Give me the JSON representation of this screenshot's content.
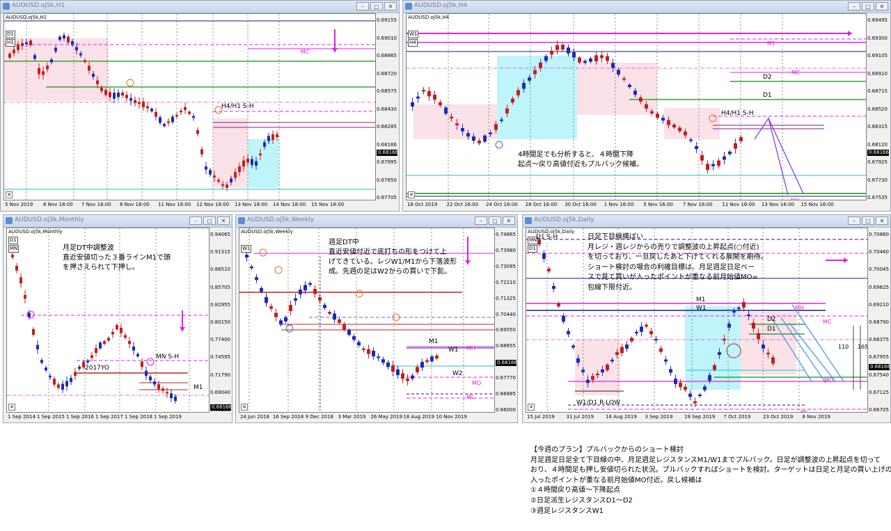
{
  "windows": [
    {
      "id": "h1",
      "title": "AUDUSD.oj5k,H1",
      "symbol": "AUDUSD.oj5k,H1",
      "tf": [
        "D1",
        "H1"
      ],
      "prices": [
        "0.69155",
        "0.69010",
        "0.68865",
        "0.68720",
        "0.68575",
        "0.68430",
        "0.68285",
        "0.68166",
        "0.67995",
        "0.67850",
        "0.67705"
      ],
      "current": "0.68166",
      "times": [
        "5 Nov 2019",
        "6 Nov 18:00",
        "7 Nov 18:00",
        "8 Nov 18:00",
        "11 Nov 18:00",
        "12 Nov 18:00",
        "13 Nov 18:00",
        "14 Nov 18:00",
        "15 Nov 18:00"
      ],
      "labels": [
        "MC",
        "H4/H1 S-H"
      ]
    },
    {
      "id": "h4",
      "title": "AUDUSD.oj5k,H4",
      "symbol": "AUDUSD.oj5k,H4",
      "tf": [
        "W1",
        "H4"
      ],
      "prices": [
        "0.69495",
        "0.69300",
        "0.69105",
        "0.68910",
        "0.68715",
        "0.68520",
        "0.68315",
        "0.68120",
        "0.67925",
        "0.67730",
        "0.67535"
      ],
      "current": "0.68166",
      "times": [
        "18 Oct 2019",
        "22 Oct 16:00",
        "24 Oct 16:00",
        "28 Oct 16:00",
        "30 Oct 16:00",
        "1 Nov 16:00",
        "5 Nov 16:00",
        "7 Nov 16:00",
        "11 Nov 16:00",
        "13 Nov 16:00",
        "15 Nov 16:00"
      ],
      "labels": [
        "M1",
        "MC",
        "D2",
        "D1",
        "H4/H1 S-H",
        "MO"
      ],
      "note": [
        "4時間足でも分析すると、４時間下降",
        "起点～戻り高値付近もプルバック候補。"
      ]
    },
    {
      "id": "mn",
      "title": "AUDUSD.oj5k,Monthly",
      "symbol": "AUDUSD.oj5k,Monthly",
      "tf": [
        "D1",
        "MN"
      ],
      "prices": [
        "0.94065",
        "0.91315",
        "0.88510",
        "0.85705",
        "0.82955",
        "0.80150",
        "0.77400",
        "0.74595",
        "0.71790",
        "0.69040",
        "0.66235"
      ],
      "current": "0.68166",
      "times": [
        "1 Sep 2014",
        "1 Sep 2015",
        "1 Sep 2016",
        "1 Sep 2017",
        "1 Sep 2018",
        "1 Sep 2019"
      ],
      "labels": [
        "MN S-H",
        "2017YO",
        "M1"
      ],
      "note": [
        "月足DT中調整波",
        "直近安値切った３番ラインM1で頭",
        "を押さえられて下押し。"
      ]
    },
    {
      "id": "w1",
      "title": "AUDUSD.oj5k,Weekly",
      "symbol": "AUDUSD.oj5k,Weekly",
      "tf": [
        "W1"
      ],
      "prices": [
        "0.74865",
        "0.73980",
        "0.73095",
        "0.72210",
        "0.71325",
        "0.70440",
        "0.69550",
        "0.68655",
        "0.68166",
        "0.67770",
        "0.66885",
        "0.66000"
      ],
      "current": "0.68166",
      "times": [
        "24 Jun 2018",
        "16 Sep 2018",
        "9 Dec 2018",
        "3 Mar 2019",
        "26 May 2019",
        "18 Aug 2019",
        "10 Nov 2019"
      ],
      "labels": [
        "M1",
        "W1",
        "MH",
        "W2",
        "MO",
        "ML"
      ],
      "note": [
        "週足DT中",
        "直近安値付近で底打ちの形をつけて上",
        "げてきている。レジW1/M1から下落波形",
        "成。先週の足はW2からの買いで下髭。"
      ]
    },
    {
      "id": "d1",
      "title": "AUDUSD.oj5k,Daily",
      "symbol": "AUDUSD.oj5k,Daily",
      "tf": [
        "MN",
        "D1"
      ],
      "prices": [
        "0.70880",
        "0.70460",
        "0.70045",
        "0.69625",
        "0.69210",
        "0.68790",
        "0.68375",
        "0.67955",
        "0.67540",
        "0.67125",
        "0.66705"
      ],
      "current": "0.68166",
      "times": [
        "15 Jul 2019",
        "31 Jul 2019",
        "16 Aug 2019",
        "3 Sep 2019",
        "19 Sep 2019",
        "7 Oct 2019",
        "23 Oct 2019",
        "8 Nov 2019"
      ],
      "labels": [
        "D1 S-H",
        "M1",
        "W1",
        "MH",
        "D2",
        "MC",
        "D1",
        "110",
        "165",
        "MO",
        "W1/D1 R-LOW",
        "ML"
      ],
      "note": [
        "日足下目線横ばい",
        "月レジ・週レジからの売りで調整波の上昇起点(○付近)",
        "を切っており、一旦戻したあと下げてくれる展開を期待。",
        "ショート検討の場合の利確目標は、月足週足日足ベー",
        "スで見て買いが入ったポイントが重なる前月始値MO=",
        "包線下限付近。"
      ]
    }
  ],
  "plan": [
    "【今週のプラン】プルバックからのショート検討",
    "月足週足日足全て下目線の中、月足週足レジスタンスM1/W1までプルバック。日足が調整波の上昇起点を切って",
    "おり、４時間足も押し安値切られた状況。プルバックすればショートを検討。ターゲットは日足と月足の買い上げの",
    "入ったポイントが重なる前月始値MO付近。戻し候補は",
    "①４時間戻り高値～下降起点",
    "②日足派生レジスタンスD1～D2",
    "③週足レジスタンスW1"
  ],
  "colors": {
    "bull": "#1f2ab8",
    "bear": "#c21f1f",
    "magenta": "#e020e0",
    "green": "#0f8f0f",
    "navy": "#1a1a8a",
    "cyan": "#bff4fb",
    "pink": "#fbe1e8"
  }
}
